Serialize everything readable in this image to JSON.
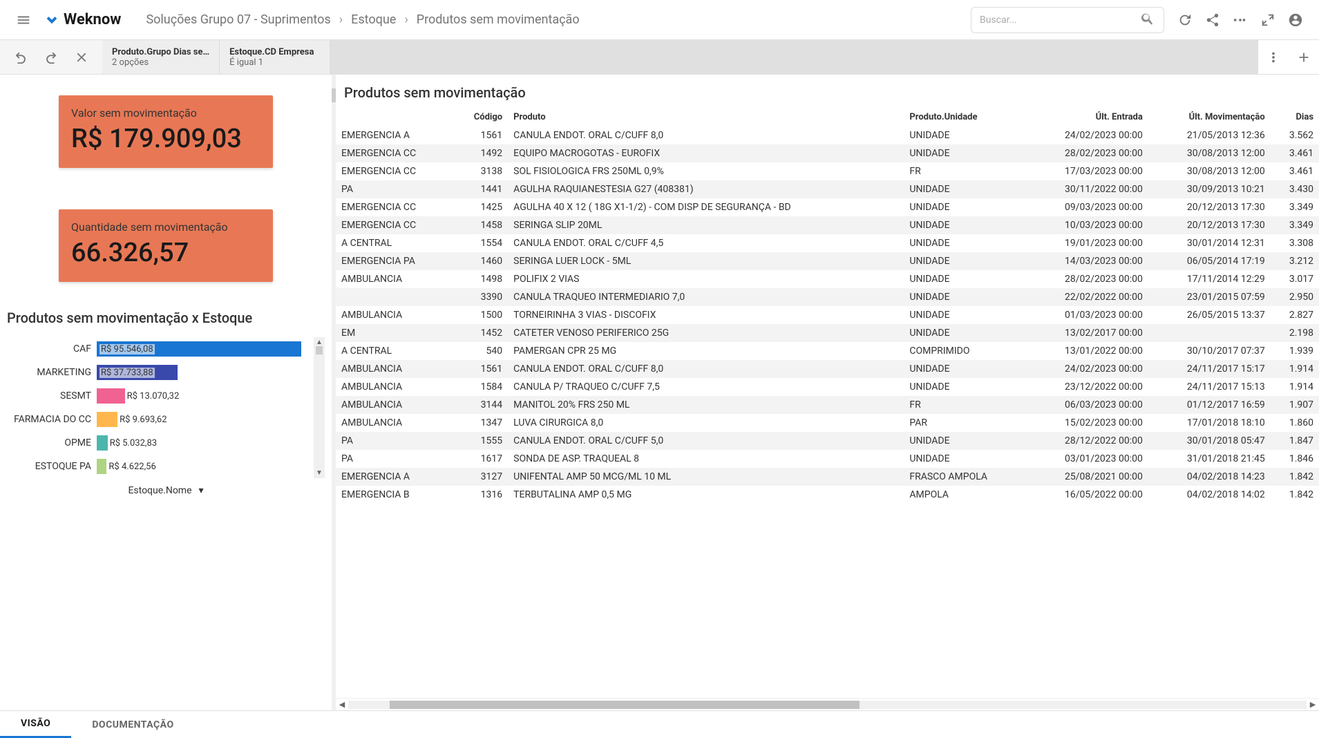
{
  "brand": "Weknow",
  "breadcrumb": [
    "Soluções Grupo 07 - Suprimentos",
    "Estoque",
    "Produtos sem movimentação"
  ],
  "search": {
    "placeholder": "Buscar..."
  },
  "filters": [
    {
      "title": "Produto.Grupo Dias se…",
      "sub": "2 opções"
    },
    {
      "title": "Estoque.CD Empresa",
      "sub": "É igual 1"
    }
  ],
  "kpis": [
    {
      "label": "Valor sem movimentação",
      "value": "R$ 179.909,03"
    },
    {
      "label": "Quantidade sem movimentação",
      "value": "66.326,57"
    }
  ],
  "chart": {
    "title": "Produtos sem movimentação x Estoque",
    "axis_label": "Estoque.Nome"
  },
  "chart_data": {
    "type": "bar",
    "orientation": "horizontal",
    "xlabel": "Estoque.Nome",
    "categories": [
      "CAF",
      "MARKETING",
      "SESMT",
      "FARMACIA DO CC",
      "OPME",
      "ESTOQUE PA"
    ],
    "values": [
      95546.08,
      37733.88,
      13070.32,
      9693.62,
      5032.83,
      4622.56
    ],
    "value_labels": [
      "R$ 95.546,08",
      "R$ 37.733,88",
      "R$ 13.070,32",
      "R$ 9.693,62",
      "R$ 5.032,83",
      "R$ 4.622,56"
    ],
    "colors": [
      "#1976d2",
      "#3949ab",
      "#f06292",
      "#ffb74d",
      "#4db6ac",
      "#aed581"
    ],
    "xlim": [
      0,
      100000
    ]
  },
  "table": {
    "title": "Produtos sem movimentação",
    "columns": [
      "",
      "Código",
      "Produto",
      "Produto.Unidade",
      "Últ. Entrada",
      "Últ. Movimentação",
      "Dias"
    ],
    "rows": [
      [
        "EMERGENCIA A",
        "1561",
        "CANULA ENDOT. ORAL C/CUFF 8,0",
        "UNIDADE",
        "24/02/2023 00:00",
        "21/05/2013 12:36",
        "3.562"
      ],
      [
        "EMERGENCIA CC",
        "1492",
        "EQUIPO MACROGOTAS - EUROFIX",
        "UNIDADE",
        "28/02/2023 00:00",
        "30/08/2013 12:00",
        "3.461"
      ],
      [
        "EMERGENCIA CC",
        "3138",
        "SOL FISIOLOGICA FRS 250ML 0,9%",
        "FR",
        "17/03/2023 00:00",
        "30/08/2013 12:00",
        "3.461"
      ],
      [
        "PA",
        "1441",
        "AGULHA RAQUIANESTESIA G27 (408381)",
        "UNIDADE",
        "30/11/2022 00:00",
        "30/09/2013 10:21",
        "3.430"
      ],
      [
        "EMERGENCIA CC",
        "1425",
        "AGULHA 40 X 12 ( 18G X1-1/2) - COM DISP DE SEGURANÇA - BD",
        "UNIDADE",
        "09/03/2023 00:00",
        "20/12/2013 17:30",
        "3.349"
      ],
      [
        "EMERGENCIA CC",
        "1458",
        "SERINGA SLIP 20ML",
        "UNIDADE",
        "10/03/2023 00:00",
        "20/12/2013 17:30",
        "3.349"
      ],
      [
        "A CENTRAL",
        "1554",
        "CANULA ENDOT. ORAL C/CUFF 4,5",
        "UNIDADE",
        "19/01/2023 00:00",
        "30/01/2014 12:31",
        "3.308"
      ],
      [
        "EMERGENCIA PA",
        "1460",
        "SERINGA LUER LOCK - 5ML",
        "UNIDADE",
        "14/03/2023 00:00",
        "06/05/2014 17:19",
        "3.212"
      ],
      [
        "AMBULANCIA",
        "1498",
        "POLIFIX 2 VIAS",
        "UNIDADE",
        "28/02/2023 00:00",
        "17/11/2014 12:29",
        "3.017"
      ],
      [
        "",
        "3390",
        "CANULA TRAQUEO INTERMEDIARIO 7,0",
        "UNIDADE",
        "22/02/2022 00:00",
        "23/01/2015 07:59",
        "2.950"
      ],
      [
        "AMBULANCIA",
        "1500",
        "TORNEIRINHA 3 VIAS - DISCOFIX",
        "UNIDADE",
        "01/03/2023 00:00",
        "26/05/2015 13:37",
        "2.827"
      ],
      [
        "EM",
        "1452",
        "CATETER VENOSO PERIFERICO 25G",
        "UNIDADE",
        "13/02/2017 00:00",
        "",
        "2.198"
      ],
      [
        "A CENTRAL",
        "540",
        "PAMERGAN CPR 25 MG",
        "COMPRIMIDO",
        "13/01/2022 00:00",
        "30/10/2017 07:37",
        "1.939"
      ],
      [
        "AMBULANCIA",
        "1561",
        "CANULA ENDOT. ORAL C/CUFF 8,0",
        "UNIDADE",
        "24/02/2023 00:00",
        "24/11/2017 15:17",
        "1.914"
      ],
      [
        "AMBULANCIA",
        "1584",
        "CANULA P/ TRAQUEO C/CUFF 7,5",
        "UNIDADE",
        "23/12/2022 00:00",
        "24/11/2017 15:13",
        "1.914"
      ],
      [
        "AMBULANCIA",
        "3144",
        "MANITOL 20% FRS 250 ML",
        "FR",
        "06/03/2023 00:00",
        "01/12/2017 16:59",
        "1.907"
      ],
      [
        "AMBULANCIA",
        "1347",
        "LUVA CIRURGICA 8,0",
        "PAR",
        "15/02/2023 00:00",
        "17/01/2018 18:10",
        "1.860"
      ],
      [
        "PA",
        "1555",
        "CANULA ENDOT. ORAL C/CUFF 5,0",
        "UNIDADE",
        "28/12/2022 00:00",
        "30/01/2018 05:47",
        "1.847"
      ],
      [
        "PA",
        "1617",
        "SONDA DE ASP. TRAQUEAL 8",
        "UNIDADE",
        "03/01/2023 00:00",
        "31/01/2018 21:45",
        "1.846"
      ],
      [
        "EMERGENCIA A",
        "3127",
        "UNIFENTAL AMP 50 MCG/ML 10 ML",
        "FRASCO AMPOLA",
        "25/08/2021 00:00",
        "04/02/2018 14:23",
        "1.842"
      ],
      [
        "EMERGENCIA B",
        "1316",
        "TERBUTALINA AMP 0,5 MG",
        "AMPOLA",
        "16/05/2022 00:00",
        "04/02/2018 14:02",
        "1.842"
      ]
    ]
  },
  "tabs": {
    "vision": "VISÃO",
    "docs": "DOCUMENTAÇÃO"
  }
}
